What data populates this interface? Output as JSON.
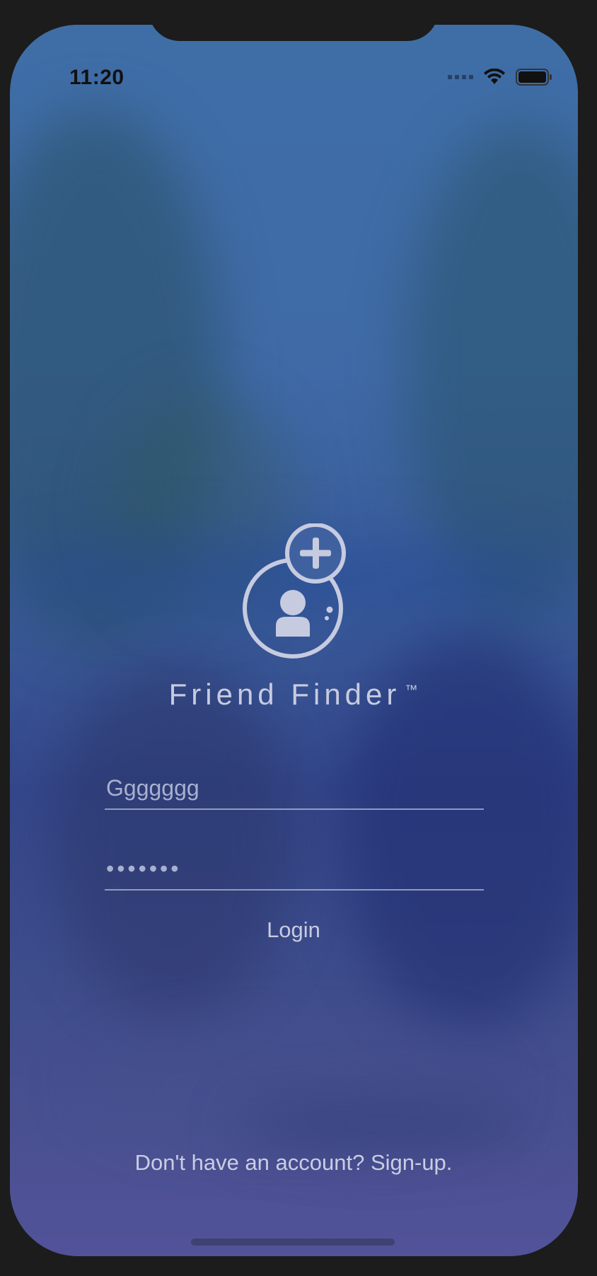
{
  "status_bar": {
    "time": "11:20",
    "icons": [
      "cellular-signal-icon",
      "wifi-icon",
      "battery-icon"
    ]
  },
  "app": {
    "name": "Friend Finder",
    "trademark": "™",
    "logo_icon": "add-friend-icon"
  },
  "login_form": {
    "username_value": "Ggggggg",
    "password_value": "•••••••",
    "login_label": "Login"
  },
  "footer": {
    "signup_text": "Don't have an account? Sign-up."
  },
  "colors": {
    "text_light": "#c7cbe0",
    "placeholder": "#a9b0cf",
    "background_top": "#3f6ea7",
    "background_bottom": "#52529a"
  }
}
